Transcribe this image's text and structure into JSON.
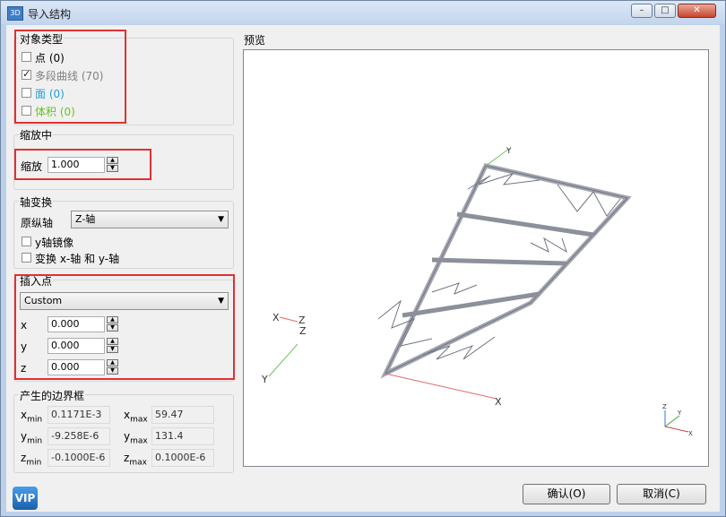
{
  "window": {
    "title": "导入结构",
    "app_icon": "3D"
  },
  "object_type": {
    "title": "对象类型",
    "items": [
      {
        "label": "点 (0)",
        "checked": false,
        "color": "#000000"
      },
      {
        "label": "多段曲线 (70)",
        "checked": true,
        "color": "#7f7f7f"
      },
      {
        "label": "面 (0)",
        "checked": false,
        "color": "#1fa0d6"
      },
      {
        "label": "体积 (0)",
        "checked": false,
        "color": "#6bbf27"
      }
    ]
  },
  "scaling": {
    "title": "缩放中",
    "label": "缩放",
    "value": "1.000"
  },
  "axis_transform": {
    "title": "轴变换",
    "vertical_axis_label": "原纵轴",
    "vertical_axis_value": "Z-轴",
    "mirror_y_label": "y轴镜像",
    "swap_xy_label": "变换 x-轴 和 y-轴"
  },
  "insertion_point": {
    "title": "插入点",
    "mode": "Custom",
    "coords": [
      {
        "label": "x",
        "value": "0.000"
      },
      {
        "label": "y",
        "value": "0.000"
      },
      {
        "label": "z",
        "value": "0.000"
      }
    ]
  },
  "bounding_box": {
    "title": "产生的边界框",
    "rows": [
      {
        "min_var": "x",
        "min_sub": "min",
        "min_value": "0.1171E-3",
        "max_var": "x",
        "max_sub": "max",
        "max_value": "59.47"
      },
      {
        "min_var": "y",
        "min_sub": "min",
        "min_value": "-9.258E-6",
        "max_var": "y",
        "max_sub": "max",
        "max_value": "131.4"
      },
      {
        "min_var": "z",
        "min_sub": "min",
        "min_value": "-0.1000E-6",
        "max_var": "z",
        "max_sub": "max",
        "max_value": "0.1000E-6"
      }
    ]
  },
  "preview": {
    "title": "预览",
    "axis_labels": {
      "top_y": "Y",
      "left_x": "X",
      "left_z_1": "Z",
      "left_z_2": "Z",
      "left_y": "Y",
      "right_x": "X"
    },
    "mini_axes": {
      "z": "Z",
      "y": "Y",
      "x": "X"
    }
  },
  "buttons": {
    "vip": "VIP",
    "ok": "确认(O)",
    "cancel": "取消(C)"
  }
}
